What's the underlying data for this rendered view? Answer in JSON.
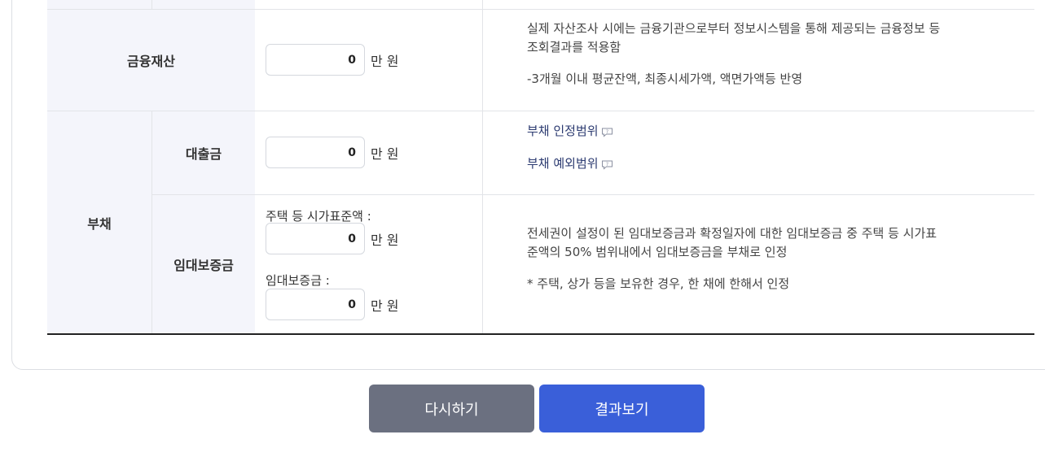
{
  "assets": {
    "financial": {
      "label": "금융재산",
      "value": "0",
      "unit": "만 원",
      "desc_line1": "실제 자산조사 시에는 금융기관으로부터 정보시스템을 통해 제공되는 금융정보 등",
      "desc_line2": "조회결과를 적용함",
      "desc_line3": "-3개월 이내 평균잔액, 최종시세가액, 액면가액등 반영"
    }
  },
  "debt": {
    "label": "부채",
    "loan": {
      "label": "대출금",
      "value": "0",
      "unit": "만 원",
      "link_scope": "부채 인정범위",
      "link_exclusion": "부채 예외범위"
    },
    "deposit": {
      "label": "임대보증금",
      "field1_label": "주택 등 시가표준액 :",
      "field1_value": "0",
      "field2_label": "임대보증금 :",
      "field2_value": "0",
      "unit": "만 원",
      "desc_line1": "전세권이 설정이 된 임대보증금과 확정일자에 대한 임대보증금 중 주택 등 시가표",
      "desc_line2": "준액의 50% 범위내에서 임대보증금을 부채로 인정",
      "desc_line3": "* 주택, 상가 등을 보유한 경우, 한 채에 한해서 인정"
    }
  },
  "buttons": {
    "reset": "다시하기",
    "result": "결과보기"
  },
  "colors": {
    "header_bg": "#f4f5fb",
    "reset_button": "#6b7080",
    "result_button": "#3a5fd9",
    "link_text": "#2b3a70"
  },
  "icons": {
    "speech_bubble": "comment-bubble-icon"
  }
}
